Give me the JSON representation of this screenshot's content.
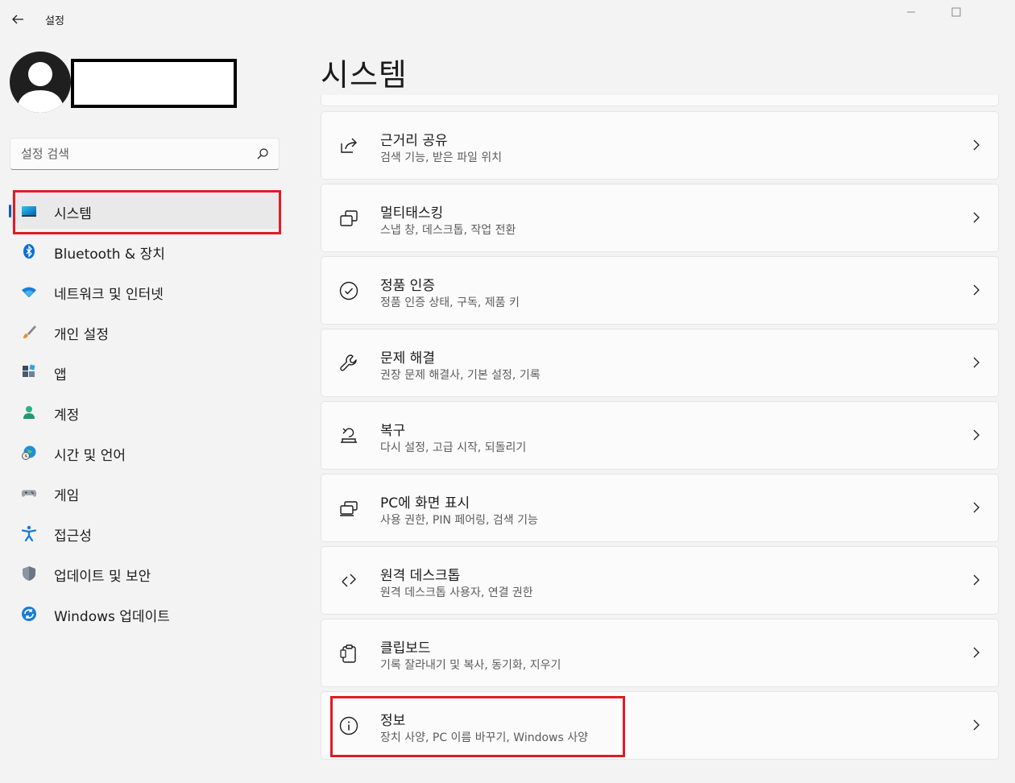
{
  "app": {
    "title": "설정"
  },
  "search": {
    "placeholder": "설정 검색"
  },
  "sidebar": {
    "items": [
      {
        "label": "시스템",
        "icon": "system-display-icon"
      },
      {
        "label": "Bluetooth & 장치",
        "icon": "bluetooth-icon"
      },
      {
        "label": "네트워크 및 인터넷",
        "icon": "wifi-icon"
      },
      {
        "label": "개인 설정",
        "icon": "brush-icon"
      },
      {
        "label": "앱",
        "icon": "apps-icon"
      },
      {
        "label": "계정",
        "icon": "account-icon"
      },
      {
        "label": "시간 및 언어",
        "icon": "globe-clock-icon"
      },
      {
        "label": "게임",
        "icon": "gamepad-icon"
      },
      {
        "label": "접근성",
        "icon": "accessibility-icon"
      },
      {
        "label": "업데이트 및 보안",
        "icon": "shield-icon"
      },
      {
        "label": "Windows 업데이트",
        "icon": "windows-update-icon"
      }
    ]
  },
  "main": {
    "title": "시스템",
    "cards": [
      {
        "title": "근거리 공유",
        "subtitle": "검색 기능, 받은 파일 위치",
        "icon": "share-icon"
      },
      {
        "title": "멀티태스킹",
        "subtitle": "스냅 창, 데스크톱, 작업 전환",
        "icon": "multitasking-icon"
      },
      {
        "title": "정품 인증",
        "subtitle": "정품 인증 상태, 구독, 제품 키",
        "icon": "check-circle-icon"
      },
      {
        "title": "문제 해결",
        "subtitle": "권장 문제 해결사, 기본 설정, 기록",
        "icon": "wrench-icon"
      },
      {
        "title": "복구",
        "subtitle": "다시 설정, 고급 시작, 되돌리기",
        "icon": "recovery-icon"
      },
      {
        "title": "PC에 화면 표시",
        "subtitle": "사용 권한, PIN 페어링, 검색 기능",
        "icon": "project-pc-icon"
      },
      {
        "title": "원격 데스크톱",
        "subtitle": "원격 데스크톱 사용자, 연결 권한",
        "icon": "remote-desktop-icon"
      },
      {
        "title": "클립보드",
        "subtitle": "기록 잘라내기 및 복사, 동기화, 지우기",
        "icon": "clipboard-icon"
      },
      {
        "title": "정보",
        "subtitle": "장치 사양, PC 이름 바꾸기, Windows 사양",
        "icon": "info-icon"
      }
    ]
  },
  "colors": {
    "accent": "#005fb8",
    "highlight": "#e01b24",
    "background": "#f3f3f3",
    "card": "#fbfbfb"
  }
}
